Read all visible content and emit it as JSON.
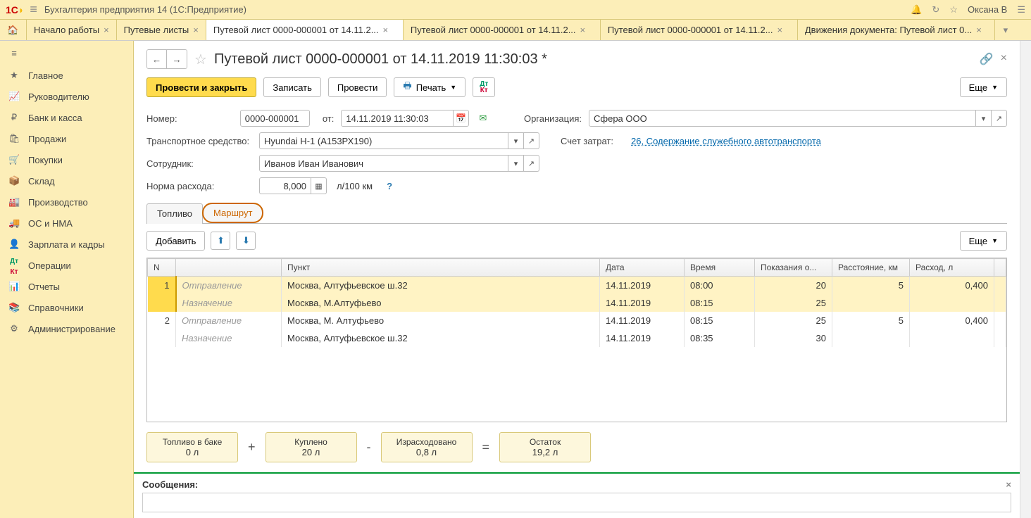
{
  "titlebar": {
    "app": "Бухгалтерия предприятия 14  (1С:Предприятие)",
    "user": "Оксана В"
  },
  "tabs": {
    "items": [
      {
        "label": "Начало работы"
      },
      {
        "label": "Путевые листы"
      },
      {
        "label": "Путевой лист 0000-000001 от 14.11.2..."
      },
      {
        "label": "Путевой лист 0000-000001 от 14.11.2..."
      },
      {
        "label": "Путевой лист 0000-000001 от 14.11.2..."
      },
      {
        "label": "Движения документа: Путевой лист 0..."
      }
    ],
    "active_index": 2
  },
  "sidebar": {
    "items": [
      {
        "icon": "★",
        "label": "Главное"
      },
      {
        "icon": "📈",
        "label": "Руководителю"
      },
      {
        "icon": "₽",
        "label": "Банк и касса"
      },
      {
        "icon": "🛍",
        "label": "Продажи"
      },
      {
        "icon": "🛒",
        "label": "Покупки"
      },
      {
        "icon": "📦",
        "label": "Склад"
      },
      {
        "icon": "🏭",
        "label": "Производство"
      },
      {
        "icon": "🚚",
        "label": "ОС и НМА"
      },
      {
        "icon": "👤",
        "label": "Зарплата и кадры"
      },
      {
        "icon": "Дт",
        "label": "Операции"
      },
      {
        "icon": "📊",
        "label": "Отчеты"
      },
      {
        "icon": "📚",
        "label": "Справочники"
      },
      {
        "icon": "⚙",
        "label": "Администрирование"
      }
    ]
  },
  "doc": {
    "title": "Путевой лист 0000-000001 от 14.11.2019 11:30:03 *"
  },
  "toolbar": {
    "post_close": "Провести и закрыть",
    "save": "Записать",
    "post": "Провести",
    "print": "Печать",
    "more": "Еще"
  },
  "form": {
    "number_label": "Номер:",
    "number": "0000-000001",
    "date_label": "от:",
    "date": "14.11.2019 11:30:03",
    "org_label": "Организация:",
    "org": "Сфера ООО",
    "vehicle_label": "Транспортное средство:",
    "vehicle": "Hyundai H-1 (А153РХ190)",
    "cost_label": "Счет затрат:",
    "cost_link": "26, Содержание служебного автотранспорта",
    "employee_label": "Сотрудник:",
    "employee": "Иванов Иван Иванович",
    "rate_label": "Норма расхода:",
    "rate": "8,000",
    "rate_unit": "л/100 км"
  },
  "innertabs": {
    "fuel": "Топливо",
    "route": "Маршрут"
  },
  "tbltoolbar": {
    "add": "Добавить",
    "more": "Еще"
  },
  "table": {
    "headers": {
      "n": "N",
      "punkt": "Пункт",
      "date": "Дата",
      "time": "Время",
      "odo": "Показания о...",
      "dist": "Расстояние, км",
      "cons": "Расход, л"
    },
    "rows": [
      {
        "n": "1",
        "type": "Отправление",
        "punkt": "Москва, Алтуфьевское ш.32",
        "date": "14.11.2019",
        "time": "08:00",
        "odo": "20",
        "dist": "5",
        "cons": "0,400",
        "sel": true
      },
      {
        "n": "",
        "type": "Назначение",
        "punkt": "Москва, М.Алтуфьево",
        "date": "14.11.2019",
        "time": "08:15",
        "odo": "25",
        "dist": "",
        "cons": "",
        "sel": true
      },
      {
        "n": "2",
        "type": "Отправление",
        "punkt": "Москва, М.  Алтуфьево",
        "date": "14.11.2019",
        "time": "08:15",
        "odo": "25",
        "dist": "5",
        "cons": "0,400",
        "sel": false
      },
      {
        "n": "",
        "type": "Назначение",
        "punkt": "Москва, Алтуфьевское ш.32",
        "date": "14.11.2019",
        "time": "08:35",
        "odo": "30",
        "dist": "",
        "cons": "",
        "sel": false
      }
    ]
  },
  "fuel": {
    "tank_t": "Топливо в баке",
    "tank_v": "0 л",
    "bought_t": "Куплено",
    "bought_v": "20 л",
    "spent_t": "Израсходовано",
    "spent_v": "0,8 л",
    "rest_t": "Остаток",
    "rest_v": "19,2 л"
  },
  "messages": {
    "label": "Сообщения:"
  }
}
